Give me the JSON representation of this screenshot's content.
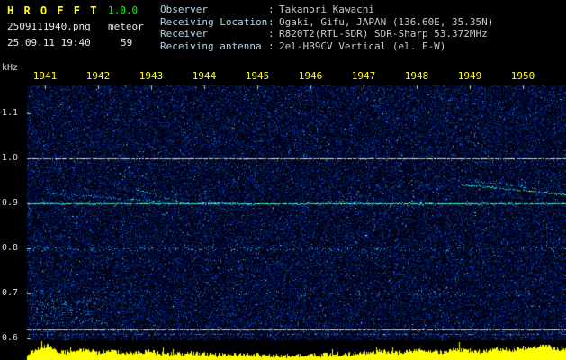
{
  "header": {
    "app_name": "H R O F F T",
    "version": "1.0.0",
    "filename": "2509111940.png",
    "mode": "meteor",
    "datetime": "25.09.11 19:40",
    "count": "59",
    "separator": ":",
    "info": [
      {
        "label": "Observer",
        "value": "Takanori Kawachi"
      },
      {
        "label": "Receiving Location",
        "value": "Ogaki, Gifu, JAPAN (136.60E, 35.35N)"
      },
      {
        "label": "Receiver",
        "value": "R820T2(RTL-SDR) SDR-Sharp 53.372MHz"
      },
      {
        "label": "Receiving antenna",
        "value": "2el-HB9CV Vertical (el. E-W)"
      }
    ]
  },
  "chart_data": {
    "type": "heatmap",
    "subtype": "radio-meteor-spectrogram",
    "title": "",
    "ylabel": "kHz",
    "x_ticks": [
      "1941",
      "1942",
      "1943",
      "1944",
      "1945",
      "1946",
      "1947",
      "1948",
      "1949",
      "1950"
    ],
    "y_ticks": [
      "1.1",
      "1.0",
      "0.9",
      "0.8",
      "0.7",
      "0.6"
    ],
    "x_range": [
      1940.66,
      1950.81
    ],
    "y_range": [
      0.596,
      1.162
    ],
    "grid": false,
    "legend": false,
    "carrier_lines": [
      {
        "freq": 1.0,
        "style": "white",
        "note": "continuous white reference line"
      },
      {
        "freq": 0.9,
        "style": "signal-green",
        "note": "continuous carrier echo line"
      },
      {
        "freq": 0.62,
        "style": "white",
        "note": "solid light line above amplitude strip"
      },
      {
        "freq": 0.61,
        "style": "faint-blue",
        "note": "faint dotted companion line"
      }
    ],
    "meteor_echoes": [
      {
        "t_start": 1941.0,
        "f_start": 0.924,
        "t_end": 1943.3,
        "f_end": 0.903,
        "intensity": 0.35
      },
      {
        "t_start": 1942.7,
        "f_start": 0.933,
        "t_end": 1943.6,
        "f_end": 0.902,
        "intensity": 0.55
      },
      {
        "t_start": 1943.6,
        "f_start": 0.903,
        "t_end": 1945.0,
        "f_end": 0.899,
        "intensity": 0.25
      },
      {
        "t_start": 1946.3,
        "f_start": 0.906,
        "t_end": 1947.4,
        "f_end": 0.901,
        "intensity": 0.2
      },
      {
        "t_start": 1947.9,
        "f_start": 0.905,
        "t_end": 1948.3,
        "f_end": 0.9,
        "intensity": 0.3
      },
      {
        "t_start": 1948.85,
        "f_start": 0.942,
        "t_end": 1950.8,
        "f_end": 0.921,
        "intensity": 0.7
      },
      {
        "t_start": 1949.1,
        "f_start": 0.95,
        "t_end": 1950.3,
        "f_end": 0.934,
        "intensity": 0.4
      }
    ],
    "speckle_bands": [
      {
        "freq": 0.8,
        "spread_khz": 0.004,
        "count": 220
      },
      {
        "freq": 0.7,
        "spread_khz": 0.006,
        "count": 90
      },
      {
        "freq": 0.66,
        "spread_khz": 0.03,
        "count": 140,
        "t_start": 1940.7,
        "t_end": 1942.2
      }
    ],
    "amplitude_strip": {
      "color": "#ffff00",
      "description": "signal-strength bar strip along bottom",
      "points": [
        [
          1940.7,
          7
        ],
        [
          1940.9,
          13
        ],
        [
          1941.05,
          16
        ],
        [
          1941.2,
          9
        ],
        [
          1941.5,
          8
        ],
        [
          1941.8,
          11
        ],
        [
          1942.0,
          8
        ],
        [
          1942.3,
          9
        ],
        [
          1942.6,
          7
        ],
        [
          1943.0,
          9
        ],
        [
          1943.3,
          6
        ],
        [
          1943.8,
          7
        ],
        [
          1944.2,
          5
        ],
        [
          1944.6,
          6
        ],
        [
          1945.0,
          5
        ],
        [
          1945.4,
          4
        ],
        [
          1945.8,
          5
        ],
        [
          1946.2,
          5
        ],
        [
          1946.6,
          6
        ],
        [
          1947.0,
          7
        ],
        [
          1947.3,
          9
        ],
        [
          1947.6,
          8
        ],
        [
          1948.0,
          10
        ],
        [
          1948.4,
          8
        ],
        [
          1948.8,
          11
        ],
        [
          1949.2,
          9
        ],
        [
          1949.5,
          12
        ],
        [
          1949.8,
          10
        ],
        [
          1950.1,
          14
        ],
        [
          1950.4,
          16
        ],
        [
          1950.6,
          12
        ],
        [
          1950.9,
          11
        ]
      ]
    }
  },
  "colors": {
    "background": "#000000",
    "noise_blue": "#0a2a96",
    "signal_green": "#46e6a0",
    "amplitude_yellow": "#ffff00",
    "tick_label_yellow": "#ffff00",
    "axis_text": "#dcdcdc",
    "header_label": "#aed6e8",
    "header_value": "#c9c9c9",
    "title_yellow": "#ffff00",
    "version_green": "#00ff00"
  }
}
